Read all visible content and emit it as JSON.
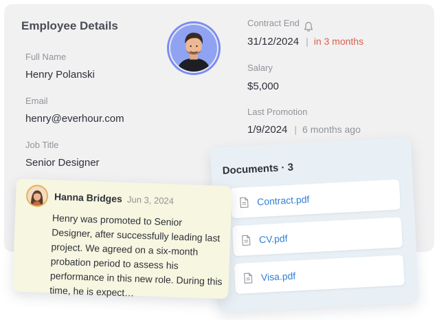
{
  "employee": {
    "title": "Employee Details",
    "full_name_label": "Full Name",
    "full_name": "Henry Polanski",
    "email_label": "Email",
    "email": "henry@everhour.com",
    "job_title_label": "Job Title",
    "job_title": "Senior Designer",
    "contract_end_label": "Contract End",
    "contract_end": "31/12/2024",
    "contract_end_separator": "|",
    "contract_end_note": "in 3 months",
    "salary_label": "Salary",
    "salary": "$5,000",
    "last_promotion_label": "Last Promotion",
    "last_promotion": "1/9/2024",
    "last_promotion_separator": "|",
    "last_promotion_note": "6 months ago",
    "avatar_icon": "person-avatar",
    "bell_icon": "bell-icon"
  },
  "documents": {
    "title": "Documents · 3",
    "items": [
      {
        "name": "Contract.pdf",
        "icon": "file-icon"
      },
      {
        "name": "CV.pdf",
        "icon": "file-icon"
      },
      {
        "name": "Visa.pdf",
        "icon": "file-icon"
      }
    ]
  },
  "comment": {
    "author": "Hanna Bridges",
    "date": "Jun 3, 2024",
    "text": "Henry was promoted to Senior Designer, after successfully leading last project. We agreed on a six-month probation period to assess his performance in this new role. During this time, he is expect…",
    "avatar_icon": "person-avatar"
  },
  "colors": {
    "link": "#2f7fd6",
    "warning": "#d9604d",
    "avatar_ring": "#7b8df0",
    "comment_bg": "#f7f6e1",
    "docs_bg": "#e9f0f5"
  }
}
